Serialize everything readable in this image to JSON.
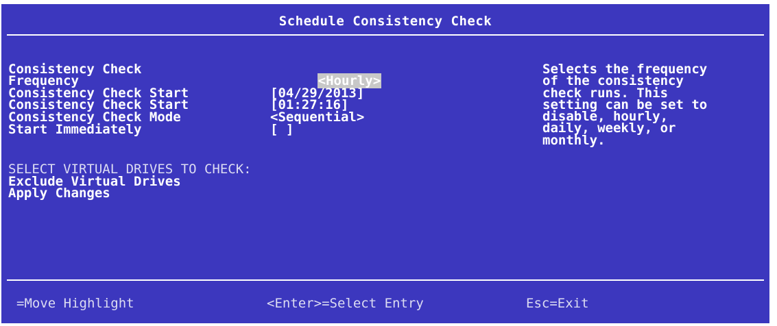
{
  "window": {
    "title": "Schedule Consistency Check"
  },
  "fields": [
    {
      "label": "Consistency Check",
      "value": "<Hourly>"
    },
    {
      "label": "Frequency",
      "value": ""
    },
    {
      "label": "Consistency Check Start",
      "value": "[04/29/2013]"
    },
    {
      "label": "Consistency Check Start",
      "value": "[01:27:16]"
    },
    {
      "label": "Consistency Check Mode",
      "value": "<Sequential>"
    },
    {
      "label": "Start Immediately",
      "value": "[ ]"
    }
  ],
  "help": {
    "lines": [
      "Selects the frequency",
      "of the consistency",
      "check runs. This",
      "setting can be set to",
      "disable, hourly,",
      "daily, weekly, or",
      "monthly."
    ]
  },
  "section": {
    "heading": "SELECT VIRTUAL DRIVES TO CHECK:"
  },
  "actions": {
    "exclude": "Exclude Virtual Drives",
    "apply": "Apply Changes"
  },
  "footer": {
    "move": "=Move Highlight",
    "select": "<Enter>=Select Entry",
    "exit": "Esc=Exit"
  },
  "colors": {
    "background": "#3c37be",
    "text": "#ffffff",
    "highlight": "#c8c8c8"
  }
}
